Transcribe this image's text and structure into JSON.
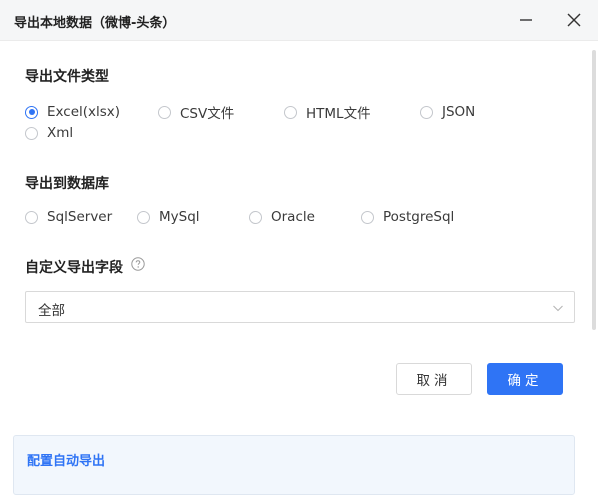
{
  "dialog": {
    "title": "导出本地数据（微博-头条）"
  },
  "file_type": {
    "heading": "导出文件类型",
    "options": [
      "Excel(xlsx)",
      "CSV文件",
      "HTML文件",
      "JSON",
      "Xml"
    ],
    "selected": "Excel(xlsx)"
  },
  "database": {
    "heading": "导出到数据库",
    "options": [
      "SqlServer",
      "MySql",
      "Oracle",
      "PostgreSql"
    ]
  },
  "custom_fields": {
    "heading": "自定义导出字段",
    "selected_value": "全部"
  },
  "buttons": {
    "cancel": "取消",
    "confirm": "确定"
  },
  "bottom_panel": {
    "label": "配置自动导出"
  },
  "colors": {
    "accent": "#2f74f5",
    "titlebar_bg": "#f5f6f7"
  }
}
